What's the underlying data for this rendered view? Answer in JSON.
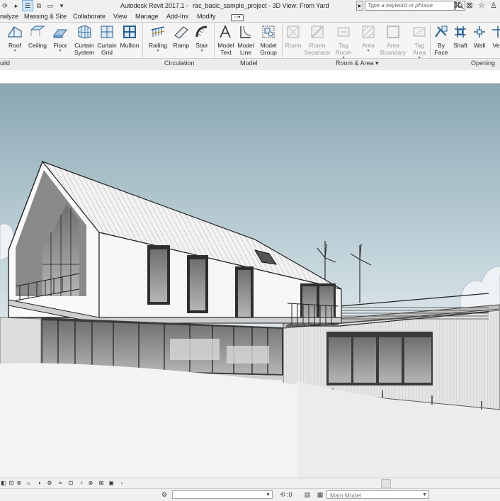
{
  "titlebar": {
    "app": "Autodesk Revit 2017.1 -",
    "project": "rac_basic_sample_project - 3D View: From Yard",
    "search_placeholder": "Type a keyword or phrase"
  },
  "menu": {
    "tabs": [
      "nalyze",
      "Massing & Site",
      "Collaborate",
      "View",
      "Manage",
      "Add-Ins",
      "Modify"
    ]
  },
  "ribbon": {
    "tools": [
      {
        "key": "roof",
        "label": "Roof",
        "label2": "",
        "dropdown": true,
        "enabled": true
      },
      {
        "key": "ceiling",
        "label": "Ceiling",
        "label2": "",
        "dropdown": false,
        "enabled": true
      },
      {
        "key": "floor",
        "label": "Floor",
        "label2": "",
        "dropdown": true,
        "enabled": true
      },
      {
        "key": "curtain_system",
        "label": "Curtain",
        "label2": "System",
        "dropdown": false,
        "enabled": true
      },
      {
        "key": "curtain_grid",
        "label": "Curtain",
        "label2": "Grid",
        "dropdown": false,
        "enabled": true
      },
      {
        "key": "mullion",
        "label": "Mullion",
        "label2": "",
        "dropdown": false,
        "enabled": true
      },
      {
        "key": "railing",
        "label": "Railing",
        "label2": "",
        "dropdown": true,
        "enabled": true
      },
      {
        "key": "ramp",
        "label": "Ramp",
        "label2": "",
        "dropdown": false,
        "enabled": true
      },
      {
        "key": "stair",
        "label": "Stair",
        "label2": "",
        "dropdown": true,
        "enabled": true
      },
      {
        "key": "model_text",
        "label": "Model",
        "label2": "Text",
        "dropdown": false,
        "enabled": true
      },
      {
        "key": "model_line",
        "label": "Model",
        "label2": "Line",
        "dropdown": false,
        "enabled": true
      },
      {
        "key": "model_group",
        "label": "Model",
        "label2": "Group",
        "dropdown": true,
        "enabled": true
      },
      {
        "key": "room",
        "label": "Room",
        "label2": "",
        "dropdown": false,
        "enabled": false
      },
      {
        "key": "room_separator",
        "label": "Room",
        "label2": "Separator",
        "dropdown": false,
        "enabled": false
      },
      {
        "key": "tag_room",
        "label": "Tag",
        "label2": "Room",
        "dropdown": true,
        "enabled": false
      },
      {
        "key": "area",
        "label": "Area",
        "label2": "",
        "dropdown": true,
        "enabled": false
      },
      {
        "key": "area_boundary",
        "label": "Area",
        "label2": "Boundary",
        "dropdown": false,
        "enabled": false
      },
      {
        "key": "tag_area",
        "label": "Tag",
        "label2": "Area",
        "dropdown": true,
        "enabled": false
      },
      {
        "key": "by_face",
        "label": "By",
        "label2": "Face",
        "dropdown": false,
        "enabled": true
      },
      {
        "key": "shaft",
        "label": "Shaft",
        "label2": "",
        "dropdown": false,
        "enabled": true
      },
      {
        "key": "wall",
        "label": "Wall",
        "label2": "",
        "dropdown": false,
        "enabled": true
      },
      {
        "key": "vertical",
        "label": "Vert",
        "label2": "",
        "dropdown": false,
        "enabled": true
      }
    ],
    "panels": [
      {
        "key": "build",
        "label": "uild"
      },
      {
        "key": "circulation",
        "label": "Circulation"
      },
      {
        "key": "model",
        "label": "Model"
      },
      {
        "key": "room_area",
        "label": "Room & Area"
      },
      {
        "key": "opening",
        "label": "Opening"
      }
    ]
  },
  "statusbar": {
    "workset_placeholder": "",
    "selection_count": ":0",
    "design_option": "Main Model"
  },
  "colors": {
    "sky_top": "#8aa7b3",
    "sky_bottom": "#e8eef1",
    "accent_selected": "#cde4f7"
  }
}
